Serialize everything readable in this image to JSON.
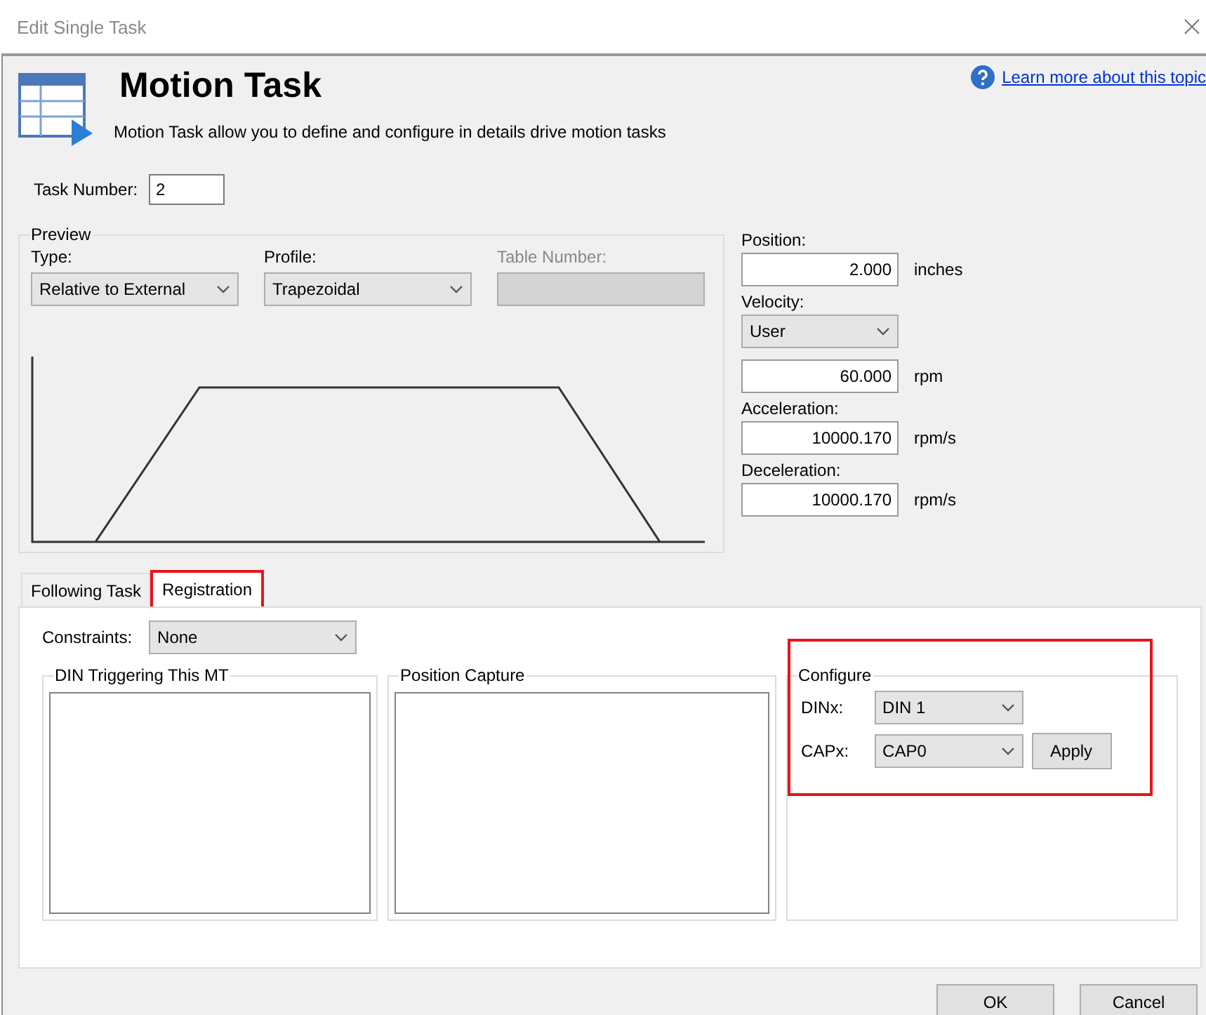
{
  "window": {
    "title": "Edit Single Task"
  },
  "header": {
    "title": "Motion Task",
    "subtitle": "Motion Task allow you to define and configure in details drive motion tasks",
    "help_link": "Learn more about this topic"
  },
  "task_number": {
    "label": "Task Number:",
    "value": "2"
  },
  "preview": {
    "title": "Preview",
    "fields": [
      {
        "label": "Type:",
        "value": "Relative to External",
        "disabled": false
      },
      {
        "label": "Profile:",
        "value": "Trapezoidal",
        "disabled": false
      },
      {
        "label": "Table Number:",
        "disabled": true
      }
    ]
  },
  "motion": [
    {
      "kind": "label",
      "text": "Position:"
    },
    {
      "kind": "input",
      "value": "2.000",
      "unit": "inches"
    },
    {
      "kind": "label",
      "text": "Velocity:"
    },
    {
      "kind": "select",
      "value": "User"
    },
    {
      "kind": "input",
      "value": "60.000",
      "unit": "rpm"
    },
    {
      "kind": "label",
      "text": "Acceleration:"
    },
    {
      "kind": "input",
      "value": "10000.170",
      "unit": "rpm/s"
    },
    {
      "kind": "label",
      "text": "Deceleration:"
    },
    {
      "kind": "input",
      "value": "10000.170",
      "unit": "rpm/s"
    }
  ],
  "tabs": [
    {
      "label": "Following Task",
      "selected": false,
      "highlighted": false
    },
    {
      "label": "Registration",
      "selected": true,
      "highlighted": true
    }
  ],
  "registration": {
    "constraints": {
      "label": "Constraints:",
      "value": "None"
    },
    "lists": [
      {
        "title": "DIN Triggering This MT"
      },
      {
        "title": "Position Capture"
      }
    ],
    "configure": {
      "title": "Configure",
      "highlighted": true,
      "rows": [
        {
          "label": "DINx:",
          "value": "DIN 1"
        },
        {
          "label": "CAPx:",
          "value": "CAP0"
        }
      ],
      "apply": "Apply"
    }
  },
  "buttons": [
    "OK",
    "Cancel"
  ]
}
